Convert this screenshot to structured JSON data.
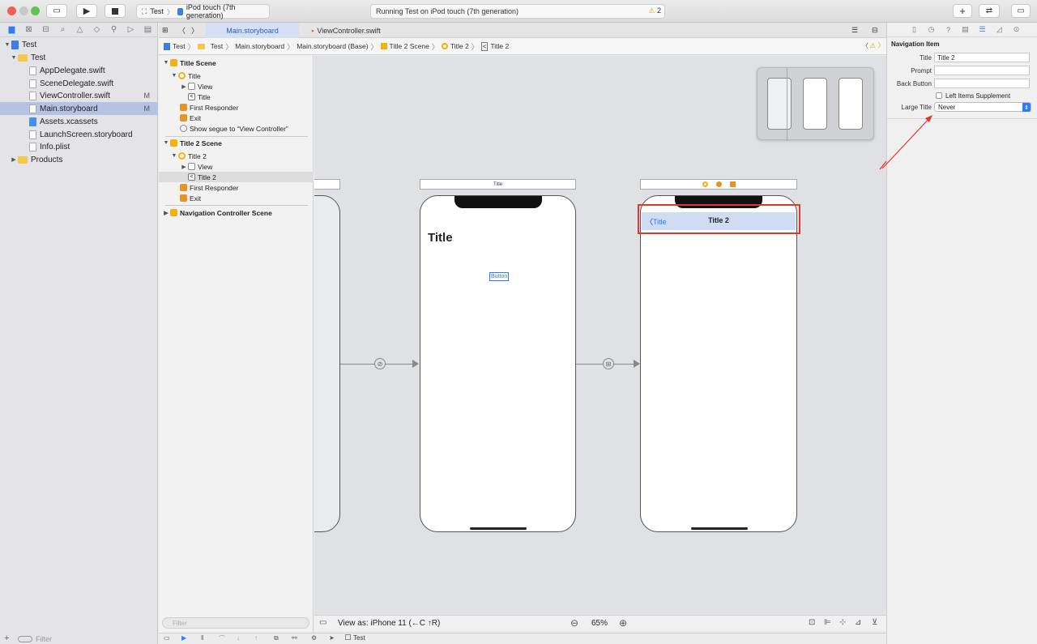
{
  "toolbar": {
    "scheme": "Test",
    "device": "iPod touch (7th generation)",
    "activity": "Running Test on iPod touch (7th generation)",
    "warning_count": "2",
    "add_icon": "plus-icon",
    "back_forward_icon": "swap-icon"
  },
  "navigator": {
    "project": "Test",
    "group": "Test",
    "files": [
      {
        "name": "AppDelegate.swift",
        "badge": ""
      },
      {
        "name": "SceneDelegate.swift",
        "badge": ""
      },
      {
        "name": "ViewController.swift",
        "badge": "M"
      },
      {
        "name": "Main.storyboard",
        "badge": "M"
      },
      {
        "name": "Assets.xcassets",
        "badge": ""
      },
      {
        "name": "LaunchScreen.storyboard",
        "badge": ""
      },
      {
        "name": "Info.plist",
        "badge": ""
      }
    ],
    "products": "Products",
    "filter_placeholder": "Filter"
  },
  "editor_tabs": [
    {
      "label": "Main.storyboard"
    },
    {
      "label": "ViewController.swift"
    }
  ],
  "jump_bar": [
    "Test",
    "Test",
    "Main.storyboard",
    "Main.storyboard (Base)",
    "Title 2 Scene",
    "Title 2",
    "Title 2"
  ],
  "outline": {
    "scene1": "Title Scene",
    "scene1_items": [
      "Title",
      "View",
      "Title",
      "First Responder",
      "Exit",
      "Show segue to “View Controller”"
    ],
    "scene2": "Title 2 Scene",
    "scene2_items": [
      "Title 2",
      "View",
      "Title 2",
      "First Responder",
      "Exit"
    ],
    "scene3": "Navigation Controller Scene",
    "filter_placeholder": "Filter"
  },
  "canvas": {
    "scene_bar_title": "Title",
    "large_title": "Title",
    "button_label": "Button",
    "back_label": "Title",
    "nav_title": "Title 2",
    "view_as": "View as: iPhone 11 (←C ↑R)",
    "zoom": "65%"
  },
  "inspector": {
    "section": "Navigation Item",
    "title_label": "Title",
    "title_value": "Title 2",
    "prompt_label": "Prompt",
    "prompt_value": "",
    "back_label": "Back Button",
    "back_value": "",
    "left_items_label": "Left Items Supplement",
    "large_title_label": "Large Title",
    "large_title_value": "Never"
  },
  "debug": {
    "target": "Test"
  },
  "colors": {
    "selection": "#b4c3e4",
    "accent": "#2f7cf6",
    "highlight_red": "#e0392b",
    "nav_bar_fill": "#cfdcf2"
  }
}
